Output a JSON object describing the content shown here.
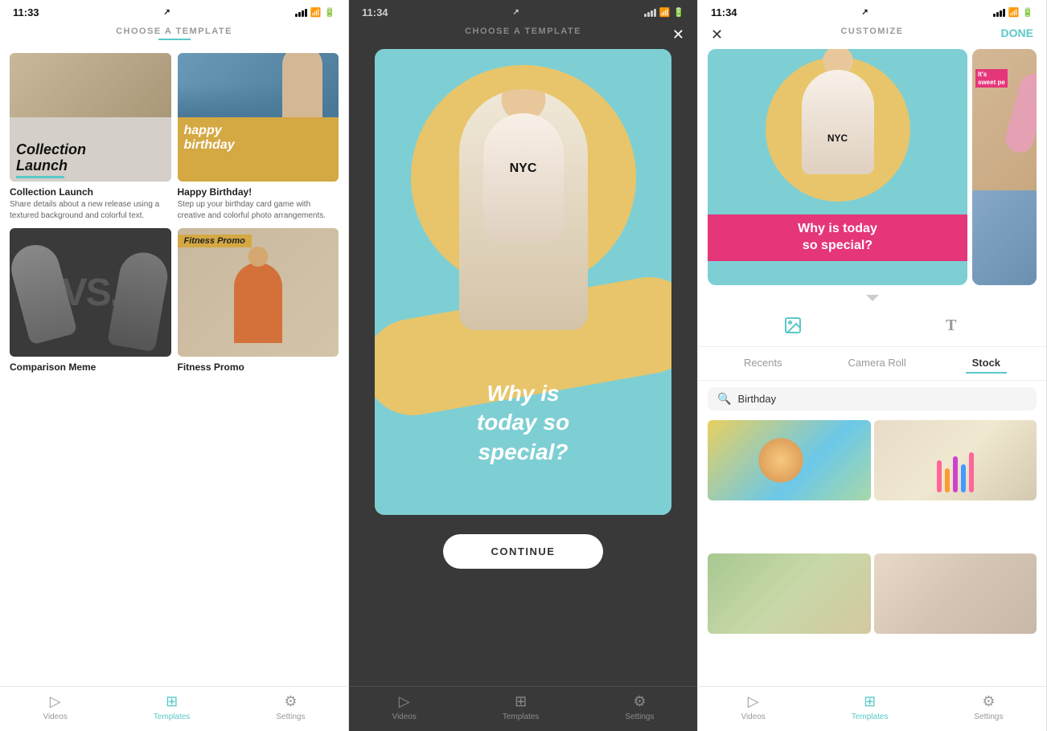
{
  "screen1": {
    "status": {
      "time": "11:33",
      "location_arrow": "↗"
    },
    "header": {
      "title": "CHOOSE A TEMPLATE"
    },
    "templates": [
      {
        "id": "collection-launch",
        "title": "Collection Launch",
        "description": "Share details about a new release using a textured background and colorful text."
      },
      {
        "id": "happy-birthday",
        "title": "Happy Birthday!",
        "description": "Step up your birthday card game with creative and colorful photo arrangements."
      },
      {
        "id": "comparison-meme",
        "title": "Comparison Meme",
        "description": ""
      },
      {
        "id": "fitness-promo",
        "title": "Fitness Promo",
        "description": ""
      }
    ],
    "nav": {
      "videos_label": "Videos",
      "templates_label": "Templates",
      "settings_label": "Settings"
    },
    "thumb_labels": {
      "collection_line1": "Collection",
      "collection_line2": "Launch",
      "birthday_line1": "happy",
      "birthday_line2": "birthday",
      "vs_text": "VS.",
      "fitness_text": "Fitness Promo"
    }
  },
  "screen2": {
    "status": {
      "time": "11:34",
      "location_arrow": "↗"
    },
    "header": {
      "title": "CHOOSE A TEMPLATE"
    },
    "preview": {
      "person_label": "NYC",
      "tagline_line1": "Why is",
      "tagline_line2": "today so",
      "tagline_line3": "special?"
    },
    "continue_label": "CONTINUE",
    "nav": {
      "videos_label": "Videos",
      "templates_label": "Templates",
      "settings_label": "Settings"
    }
  },
  "screen3": {
    "status": {
      "time": "11:34",
      "location_arrow": "↗"
    },
    "header": {
      "title": "CUSTOMIZE",
      "done_label": "DONE"
    },
    "preview": {
      "person_label": "NYC",
      "why_text_line1": "Why is today",
      "why_text_line2": "so special?",
      "side_label_line1": "It's",
      "side_label_line2": "sweet pe"
    },
    "tools": {
      "image_icon": "🖼",
      "text_icon": "T"
    },
    "photo_tabs": {
      "recents": "Recents",
      "camera_roll": "Camera Roll",
      "stock": "Stock"
    },
    "search": {
      "placeholder": "Birthday",
      "value": "Birthday"
    },
    "nav": {
      "videos_label": "Videos",
      "templates_label": "Templates",
      "settings_label": "Settings"
    }
  }
}
